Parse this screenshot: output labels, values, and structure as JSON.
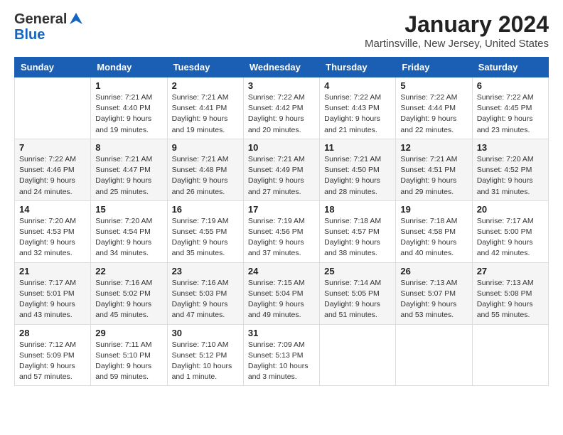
{
  "header": {
    "logo_general": "General",
    "logo_blue": "Blue",
    "month_title": "January 2024",
    "location": "Martinsville, New Jersey, United States"
  },
  "days_of_week": [
    "Sunday",
    "Monday",
    "Tuesday",
    "Wednesday",
    "Thursday",
    "Friday",
    "Saturday"
  ],
  "weeks": [
    [
      {
        "day": "",
        "sunrise": "",
        "sunset": "",
        "daylight": ""
      },
      {
        "day": "1",
        "sunrise": "Sunrise: 7:21 AM",
        "sunset": "Sunset: 4:40 PM",
        "daylight": "Daylight: 9 hours and 19 minutes."
      },
      {
        "day": "2",
        "sunrise": "Sunrise: 7:21 AM",
        "sunset": "Sunset: 4:41 PM",
        "daylight": "Daylight: 9 hours and 19 minutes."
      },
      {
        "day": "3",
        "sunrise": "Sunrise: 7:22 AM",
        "sunset": "Sunset: 4:42 PM",
        "daylight": "Daylight: 9 hours and 20 minutes."
      },
      {
        "day": "4",
        "sunrise": "Sunrise: 7:22 AM",
        "sunset": "Sunset: 4:43 PM",
        "daylight": "Daylight: 9 hours and 21 minutes."
      },
      {
        "day": "5",
        "sunrise": "Sunrise: 7:22 AM",
        "sunset": "Sunset: 4:44 PM",
        "daylight": "Daylight: 9 hours and 22 minutes."
      },
      {
        "day": "6",
        "sunrise": "Sunrise: 7:22 AM",
        "sunset": "Sunset: 4:45 PM",
        "daylight": "Daylight: 9 hours and 23 minutes."
      }
    ],
    [
      {
        "day": "7",
        "sunrise": "Sunrise: 7:22 AM",
        "sunset": "Sunset: 4:46 PM",
        "daylight": "Daylight: 9 hours and 24 minutes."
      },
      {
        "day": "8",
        "sunrise": "Sunrise: 7:21 AM",
        "sunset": "Sunset: 4:47 PM",
        "daylight": "Daylight: 9 hours and 25 minutes."
      },
      {
        "day": "9",
        "sunrise": "Sunrise: 7:21 AM",
        "sunset": "Sunset: 4:48 PM",
        "daylight": "Daylight: 9 hours and 26 minutes."
      },
      {
        "day": "10",
        "sunrise": "Sunrise: 7:21 AM",
        "sunset": "Sunset: 4:49 PM",
        "daylight": "Daylight: 9 hours and 27 minutes."
      },
      {
        "day": "11",
        "sunrise": "Sunrise: 7:21 AM",
        "sunset": "Sunset: 4:50 PM",
        "daylight": "Daylight: 9 hours and 28 minutes."
      },
      {
        "day": "12",
        "sunrise": "Sunrise: 7:21 AM",
        "sunset": "Sunset: 4:51 PM",
        "daylight": "Daylight: 9 hours and 29 minutes."
      },
      {
        "day": "13",
        "sunrise": "Sunrise: 7:20 AM",
        "sunset": "Sunset: 4:52 PM",
        "daylight": "Daylight: 9 hours and 31 minutes."
      }
    ],
    [
      {
        "day": "14",
        "sunrise": "Sunrise: 7:20 AM",
        "sunset": "Sunset: 4:53 PM",
        "daylight": "Daylight: 9 hours and 32 minutes."
      },
      {
        "day": "15",
        "sunrise": "Sunrise: 7:20 AM",
        "sunset": "Sunset: 4:54 PM",
        "daylight": "Daylight: 9 hours and 34 minutes."
      },
      {
        "day": "16",
        "sunrise": "Sunrise: 7:19 AM",
        "sunset": "Sunset: 4:55 PM",
        "daylight": "Daylight: 9 hours and 35 minutes."
      },
      {
        "day": "17",
        "sunrise": "Sunrise: 7:19 AM",
        "sunset": "Sunset: 4:56 PM",
        "daylight": "Daylight: 9 hours and 37 minutes."
      },
      {
        "day": "18",
        "sunrise": "Sunrise: 7:18 AM",
        "sunset": "Sunset: 4:57 PM",
        "daylight": "Daylight: 9 hours and 38 minutes."
      },
      {
        "day": "19",
        "sunrise": "Sunrise: 7:18 AM",
        "sunset": "Sunset: 4:58 PM",
        "daylight": "Daylight: 9 hours and 40 minutes."
      },
      {
        "day": "20",
        "sunrise": "Sunrise: 7:17 AM",
        "sunset": "Sunset: 5:00 PM",
        "daylight": "Daylight: 9 hours and 42 minutes."
      }
    ],
    [
      {
        "day": "21",
        "sunrise": "Sunrise: 7:17 AM",
        "sunset": "Sunset: 5:01 PM",
        "daylight": "Daylight: 9 hours and 43 minutes."
      },
      {
        "day": "22",
        "sunrise": "Sunrise: 7:16 AM",
        "sunset": "Sunset: 5:02 PM",
        "daylight": "Daylight: 9 hours and 45 minutes."
      },
      {
        "day": "23",
        "sunrise": "Sunrise: 7:16 AM",
        "sunset": "Sunset: 5:03 PM",
        "daylight": "Daylight: 9 hours and 47 minutes."
      },
      {
        "day": "24",
        "sunrise": "Sunrise: 7:15 AM",
        "sunset": "Sunset: 5:04 PM",
        "daylight": "Daylight: 9 hours and 49 minutes."
      },
      {
        "day": "25",
        "sunrise": "Sunrise: 7:14 AM",
        "sunset": "Sunset: 5:05 PM",
        "daylight": "Daylight: 9 hours and 51 minutes."
      },
      {
        "day": "26",
        "sunrise": "Sunrise: 7:13 AM",
        "sunset": "Sunset: 5:07 PM",
        "daylight": "Daylight: 9 hours and 53 minutes."
      },
      {
        "day": "27",
        "sunrise": "Sunrise: 7:13 AM",
        "sunset": "Sunset: 5:08 PM",
        "daylight": "Daylight: 9 hours and 55 minutes."
      }
    ],
    [
      {
        "day": "28",
        "sunrise": "Sunrise: 7:12 AM",
        "sunset": "Sunset: 5:09 PM",
        "daylight": "Daylight: 9 hours and 57 minutes."
      },
      {
        "day": "29",
        "sunrise": "Sunrise: 7:11 AM",
        "sunset": "Sunset: 5:10 PM",
        "daylight": "Daylight: 9 hours and 59 minutes."
      },
      {
        "day": "30",
        "sunrise": "Sunrise: 7:10 AM",
        "sunset": "Sunset: 5:12 PM",
        "daylight": "Daylight: 10 hours and 1 minute."
      },
      {
        "day": "31",
        "sunrise": "Sunrise: 7:09 AM",
        "sunset": "Sunset: 5:13 PM",
        "daylight": "Daylight: 10 hours and 3 minutes."
      },
      {
        "day": "",
        "sunrise": "",
        "sunset": "",
        "daylight": ""
      },
      {
        "day": "",
        "sunrise": "",
        "sunset": "",
        "daylight": ""
      },
      {
        "day": "",
        "sunrise": "",
        "sunset": "",
        "daylight": ""
      }
    ]
  ]
}
